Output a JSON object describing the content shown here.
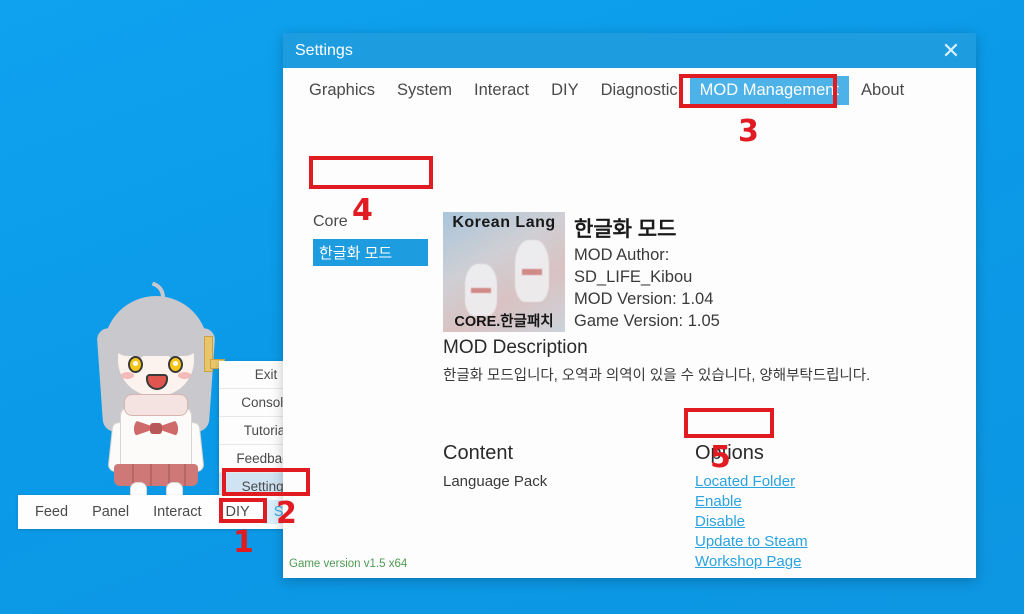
{
  "desktop": {
    "background_color": "#0b9ae8"
  },
  "taskbar": {
    "items": [
      {
        "label": "Feed",
        "active": false
      },
      {
        "label": "Panel",
        "active": false
      },
      {
        "label": "Interact",
        "active": false
      },
      {
        "label": "DIY",
        "active": false
      },
      {
        "label": "System",
        "active": true
      }
    ]
  },
  "context_menu": {
    "items": [
      {
        "label": "Exit"
      },
      {
        "label": "Console"
      },
      {
        "label": "Tutorial"
      },
      {
        "label": "Feedback"
      },
      {
        "label": "Settings"
      }
    ]
  },
  "window": {
    "title": "Settings",
    "close_icon": "✕",
    "titlebar_color": "#1e9ce0",
    "tabs": [
      {
        "label": "Graphics",
        "active": false
      },
      {
        "label": "System",
        "active": false
      },
      {
        "label": "Interact",
        "active": false
      },
      {
        "label": "DIY",
        "active": false
      },
      {
        "label": "Diagnostic",
        "active": false
      },
      {
        "label": "MOD Management",
        "active": true
      },
      {
        "label": "About",
        "active": false
      }
    ],
    "sidebar": {
      "section_label": "Core",
      "mods": [
        {
          "label": "한글화 모드",
          "selected": true
        }
      ]
    },
    "mod_detail": {
      "thumbnail_top_text": "Korean Lang",
      "thumbnail_bottom_text": "CORE.한글패치",
      "title": "한글화 모드",
      "author_label": "MOD Author:",
      "author_value": "SD_LIFE_Kibou",
      "mod_version": "MOD Version: 1.04",
      "game_version": "Game Version: 1.05",
      "description_heading": "MOD Description",
      "description_text": "한글화 모드입니다, 오역과 의역이 있을 수 있습니다, 양해부탁드립니다."
    },
    "content_section": {
      "heading": "Content",
      "items": [
        "Language Pack"
      ]
    },
    "options_section": {
      "heading": "Options",
      "links": [
        {
          "label": "Located Folder"
        },
        {
          "label": "Enable"
        },
        {
          "label": "Disable"
        },
        {
          "label": "Update to Steam"
        },
        {
          "label": "Workshop Page"
        }
      ]
    },
    "footer": {
      "game_version": "Game version v1.5 x64",
      "color": "#4e9a52"
    }
  },
  "annotations": {
    "color": "#e01b22",
    "markers": [
      {
        "number": "1"
      },
      {
        "number": "2"
      },
      {
        "number": "3"
      },
      {
        "number": "4"
      },
      {
        "number": "5"
      }
    ]
  }
}
